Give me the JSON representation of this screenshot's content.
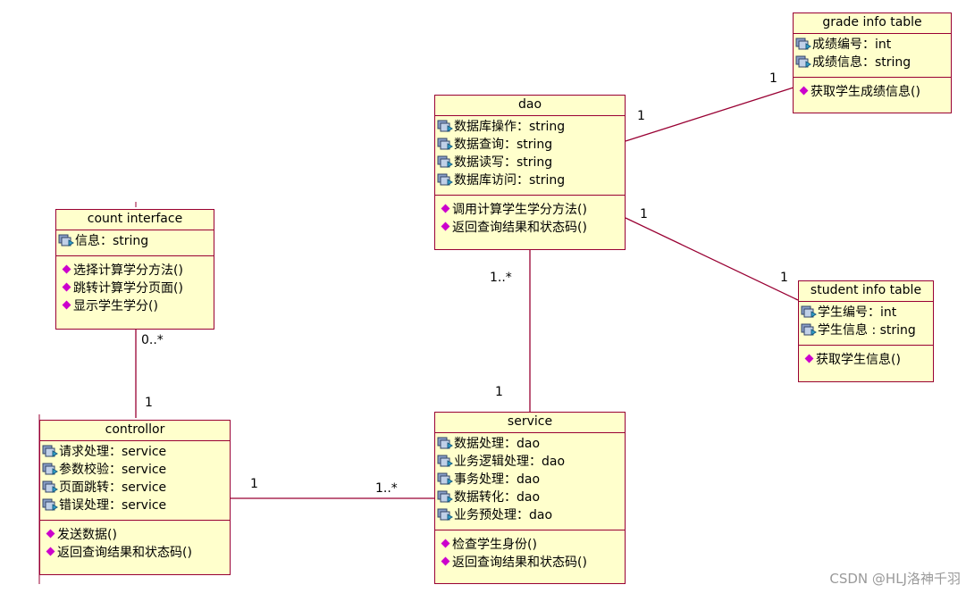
{
  "classes": {
    "grade": {
      "name": "grade info table",
      "attributes": [
        "成绩编号：int",
        "成绩信息：string"
      ],
      "operations": [
        "获取学生成绩信息()"
      ]
    },
    "dao": {
      "name": "dao",
      "attributes": [
        "数据库操作：string",
        "数据查询：string",
        "数据读写：string",
        "数据库访问：string"
      ],
      "operations": [
        "调用计算学生学分方法()",
        "返回查询结果和状态码()"
      ]
    },
    "count": {
      "name": "count interface",
      "attributes": [
        "信息：string"
      ],
      "operations": [
        "选择计算学分方法()",
        "跳转计算学分页面()",
        "显示学生学分()"
      ]
    },
    "student": {
      "name": "student info table",
      "attributes": [
        "学生编号：int",
        "学生信息 : string"
      ],
      "operations": [
        "获取学生信息()"
      ]
    },
    "controller": {
      "name": "controllor",
      "attributes": [
        "请求处理：service",
        "参数校验：service",
        "页面跳转：service",
        "错误处理：service"
      ],
      "operations": [
        "发送数据()",
        "返回查询结果和状态码()"
      ]
    },
    "service": {
      "name": "service",
      "attributes": [
        "数据处理：dao",
        "业务逻辑处理：dao",
        "事务处理：dao",
        "数据转化：dao",
        "业务预处理：dao"
      ],
      "operations": [
        "检查学生身份()",
        "返回查询结果和状态码()"
      ]
    }
  },
  "multiplicities": {
    "dao_grade_dao": "1",
    "dao_grade_grade": "1",
    "dao_student_dao": "1",
    "dao_student_student": "1",
    "dao_service_dao": "1..*",
    "dao_service_service": "1",
    "count_controller_count": "0..*",
    "count_controller_controller": "1",
    "controller_service_controller": "1",
    "controller_service_service": "1..*"
  },
  "colors": {
    "class_fill": "#ffffcc",
    "border": "#990033",
    "line": "#990033",
    "operation_icon": "#cc00cc"
  },
  "watermark": "CSDN @HLJ洛神千羽"
}
